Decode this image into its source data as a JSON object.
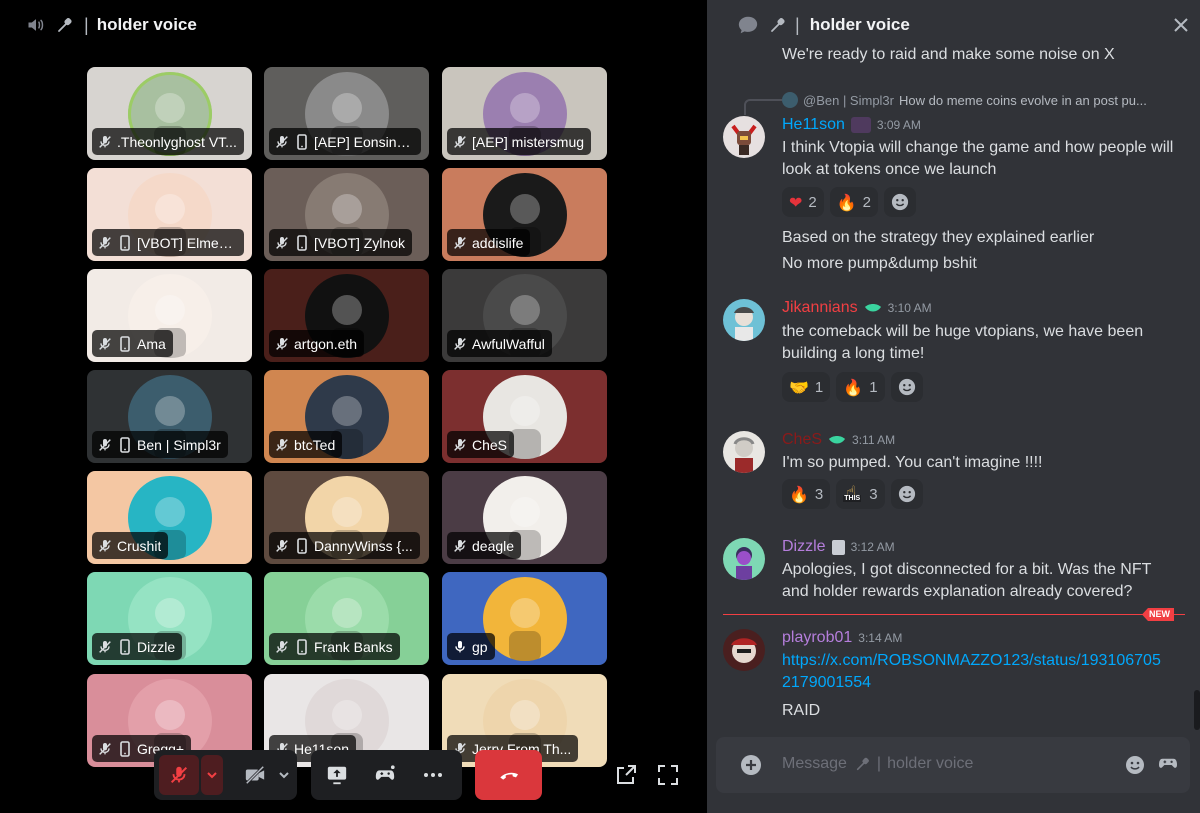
{
  "voice": {
    "channel_name": "holder voice",
    "separator": "|",
    "participants": [
      {
        "name": ".Theonlyghost VT...",
        "mobile": false,
        "bg": "#d7d4d0",
        "avbg": "#a8c0a0",
        "ring": "#9ccc65"
      },
      {
        "name": "[AEP] Eonsin | ...",
        "mobile": true,
        "bg": "#5f5e5c",
        "avbg": "#8a8a8a"
      },
      {
        "name": "[AEP] mistersmug",
        "mobile": false,
        "bg": "#c9c5bd",
        "avbg": "#9b7fb0"
      },
      {
        "name": "[VBOT] Elmer (...",
        "mobile": true,
        "bg": "#f3dfd6",
        "avbg": "#f5d9c9"
      },
      {
        "name": "[VBOT] Zylnok",
        "mobile": true,
        "bg": "#6b5e58",
        "avbg": "#877b73"
      },
      {
        "name": "addislife",
        "mobile": false,
        "bg": "#c97c5d",
        "avbg": "#1a1a1a"
      },
      {
        "name": "Ama",
        "mobile": true,
        "bg": "#f2ebe6",
        "avbg": "#f7efe9"
      },
      {
        "name": "artgon.eth",
        "mobile": false,
        "bg": "#4a1f1a",
        "avbg": "#111"
      },
      {
        "name": "AwfulWafful",
        "mobile": false,
        "bg": "#3b3a3a",
        "avbg": "#4a4a4a"
      },
      {
        "name": "Ben | Simpl3r",
        "mobile": true,
        "bg": "#2f3234",
        "avbg": "#3c5d6d"
      },
      {
        "name": "btcTed",
        "mobile": false,
        "bg": "#d08650",
        "avbg": "#2f3a4a"
      },
      {
        "name": "CheS",
        "mobile": false,
        "bg": "#7c2f2f",
        "avbg": "#e8e6e2"
      },
      {
        "name": "Crushit",
        "mobile": false,
        "bg": "#f4c7a3",
        "avbg": "#27b5c4"
      },
      {
        "name": "DannyWinss {...",
        "mobile": true,
        "bg": "#5e4a3f",
        "avbg": "#f2d5a8"
      },
      {
        "name": "deagle",
        "mobile": false,
        "bg": "#4b3c45",
        "avbg": "#f2efeb"
      },
      {
        "name": "Dizzle",
        "mobile": true,
        "bg": "#7ed8b4",
        "avbg": "#95e3c3"
      },
      {
        "name": "Frank Banks",
        "mobile": true,
        "bg": "#86d097",
        "avbg": "#9bdcaa"
      },
      {
        "name": "gp",
        "mobile": false,
        "bg": "#3f67c0",
        "avbg": "#f2b53a"
      },
      {
        "name": "Gregg+",
        "mobile": true,
        "bg": "#d98e9a",
        "avbg": "#e39fa9"
      },
      {
        "name": "He11son",
        "mobile": false,
        "bg": "#e9e6e6",
        "avbg": "#e0d9d9"
      },
      {
        "name": "Jerry From Th...",
        "mobile": false,
        "bg": "#f0dcb8",
        "avbg": "#eed5ac"
      }
    ],
    "controls": {
      "mute_icon": "mic-muted-icon",
      "camera_icon": "camera-off-icon",
      "share_icon": "screen-share-icon",
      "activity_icon": "gamepad-icon",
      "more_icon": "more-icon",
      "leave_icon": "hang-up-icon",
      "popout_icon": "popout-icon",
      "fullscreen_icon": "fullscreen-icon"
    }
  },
  "chat": {
    "channel_name": "holder voice",
    "separator": "|",
    "intro_line": "We're ready to raid and make some noise on X",
    "messages": [
      {
        "reply_to_user": "@Ben | Simpl3r",
        "reply_preview": "How do meme coins evolve in an post pu...",
        "author": "He11son",
        "author_color": "#00a8fc",
        "time": "3:09 AM",
        "lines": [
          "I think Vtopia will change the game and how people will look at tokens once we launch"
        ],
        "reactions": [
          {
            "emoji": "❤",
            "count": "2",
            "color": "#e5333b"
          },
          {
            "emoji": "🔥",
            "count": "2",
            "color": "#f5901e"
          }
        ],
        "followups": [
          "Based on the strategy they explained earlier",
          "No more pump&dump bshit"
        ]
      },
      {
        "author": "Jikannians",
        "author_color": "#f23f43",
        "time": "3:10 AM",
        "lines": [
          "the comeback will be huge vtopians, we have been building a long time!"
        ],
        "reactions": [
          {
            "emoji": "🤝",
            "count": "1",
            "color": "#f6c35b"
          },
          {
            "emoji": "🔥",
            "count": "1",
            "color": "#f5901e"
          }
        ]
      },
      {
        "author": "CheS",
        "author_color": "#8b1a1a",
        "time": "3:11 AM",
        "lines": [
          "I'm so pumped. You can't imagine !!!!"
        ],
        "reactions": [
          {
            "emoji": "🔥",
            "count": "3",
            "color": "#f5901e"
          },
          {
            "emoji": "☝",
            "count": "3",
            "color": "#f6c35b",
            "badge": "THIS"
          }
        ]
      },
      {
        "author": "Dizzle",
        "author_color": "#b57edc",
        "time": "3:12 AM",
        "lines": [
          "Apologies, I got disconnected for a bit. Was the NFT and holder rewards explanation already covered?"
        ]
      },
      {
        "author": "playrob01",
        "author_color": "#b57edc",
        "time": "3:14 AM",
        "link": "https://x.com/ROBSONMAZZO123/status/1931067052179001554",
        "link_line1": "https://x.com/ROBSONMAZZO123/status/193106705",
        "link_line2": "2179001554",
        "lines": [
          "RAID"
        ]
      }
    ],
    "new_badge": "NEW",
    "composer": {
      "placeholder_prefix": "Message",
      "channel": "holder voice"
    },
    "colors": {
      "accent_link": "#00a8fc",
      "new_divider": "#f23f43"
    }
  }
}
